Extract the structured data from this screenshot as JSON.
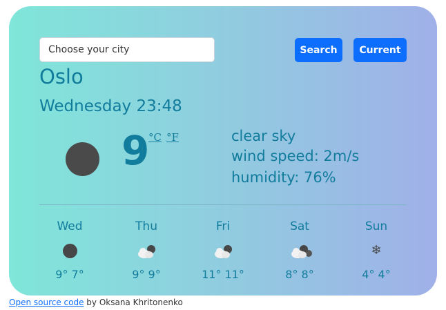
{
  "search": {
    "placeholder": "Choose your city",
    "search_label": "Search",
    "current_label": "Current"
  },
  "weather": {
    "city": "Oslo",
    "datetime": "Wednesday 23:48",
    "temperature": "9",
    "unit_c": "°C",
    "unit_f": "°F",
    "description": "clear sky",
    "wind": "wind speed: 2m/s",
    "humidity": "humidity: 76%",
    "icon": "clear-night-moon-icon"
  },
  "forecast": [
    {
      "day": "Wed",
      "temps": "9° 7°",
      "icon": "clear-night-icon"
    },
    {
      "day": "Thu",
      "temps": "9° 9°",
      "icon": "partly-cloudy-night-icon"
    },
    {
      "day": "Fri",
      "temps": "11° 11°",
      "icon": "partly-cloudy-night-icon"
    },
    {
      "day": "Sat",
      "temps": "8° 8°",
      "icon": "cloudy-night-icon"
    },
    {
      "day": "Sun",
      "temps": "4° 4°",
      "icon": "snowflake-icon"
    }
  ],
  "footer": {
    "link_text": "Open source code",
    "byline": " by Oksana Khritonenko"
  },
  "colors": {
    "accent": "#127c9c",
    "button": "#0d6efd"
  }
}
